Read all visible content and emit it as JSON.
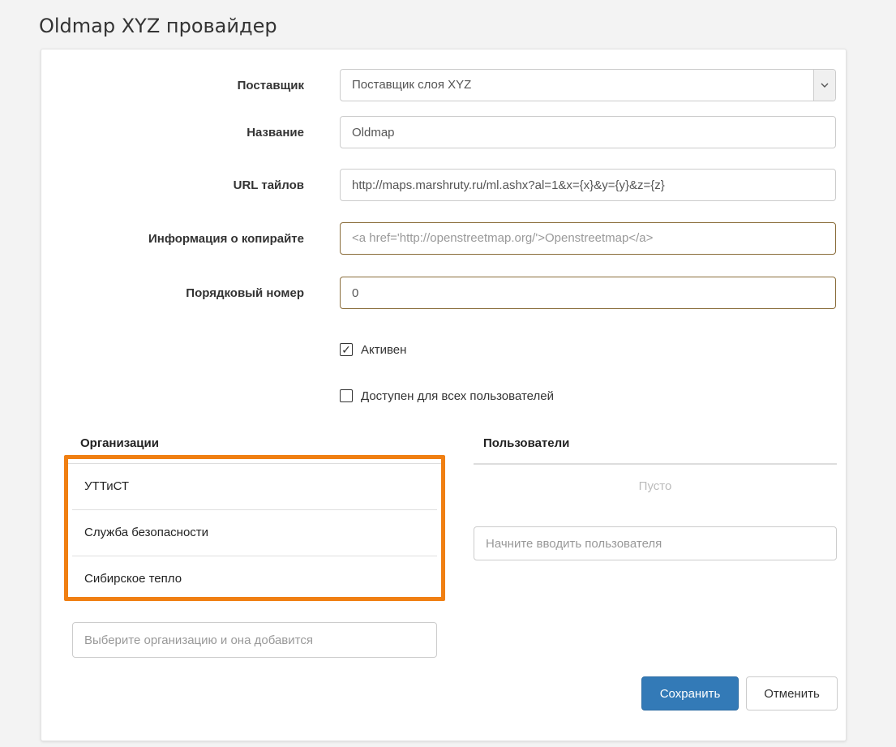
{
  "page": {
    "title": "Oldmap XYZ провайдер"
  },
  "form": {
    "provider": {
      "label": "Поставщик",
      "value": "Поставщик слоя XYZ"
    },
    "name": {
      "label": "Название",
      "value": "Oldmap"
    },
    "tile_url": {
      "label": "URL тайлов",
      "value": "http://maps.marshruty.ru/ml.ashx?al=1&x={x}&y={y}&z={z}"
    },
    "copyright": {
      "label": "Информация о копирайте",
      "placeholder": "<a href='http://openstreetmap.org/'>Openstreetmap</a>"
    },
    "order": {
      "label": "Порядковый номер",
      "value": "0"
    },
    "active": {
      "label": "Активен",
      "checked": true,
      "mark": "✓"
    },
    "public": {
      "label": "Доступен для всех пользователей",
      "checked": false
    }
  },
  "organizations": {
    "title": "Организации",
    "items": [
      "УТТиСТ",
      "Служба безопасности",
      "Сибирское тепло"
    ],
    "input_placeholder": "Выберите организацию и она добавится"
  },
  "users": {
    "title": "Пользователи",
    "empty_text": "Пусто",
    "input_placeholder": "Начните вводить пользователя"
  },
  "actions": {
    "save_label": "Сохранить",
    "cancel_label": "Отменить"
  },
  "colors": {
    "accent": "#337ab7",
    "highlight": "#f07f12"
  },
  "icons": {
    "select_arrow": "chevron-down-icon",
    "check": "checkmark-icon"
  }
}
